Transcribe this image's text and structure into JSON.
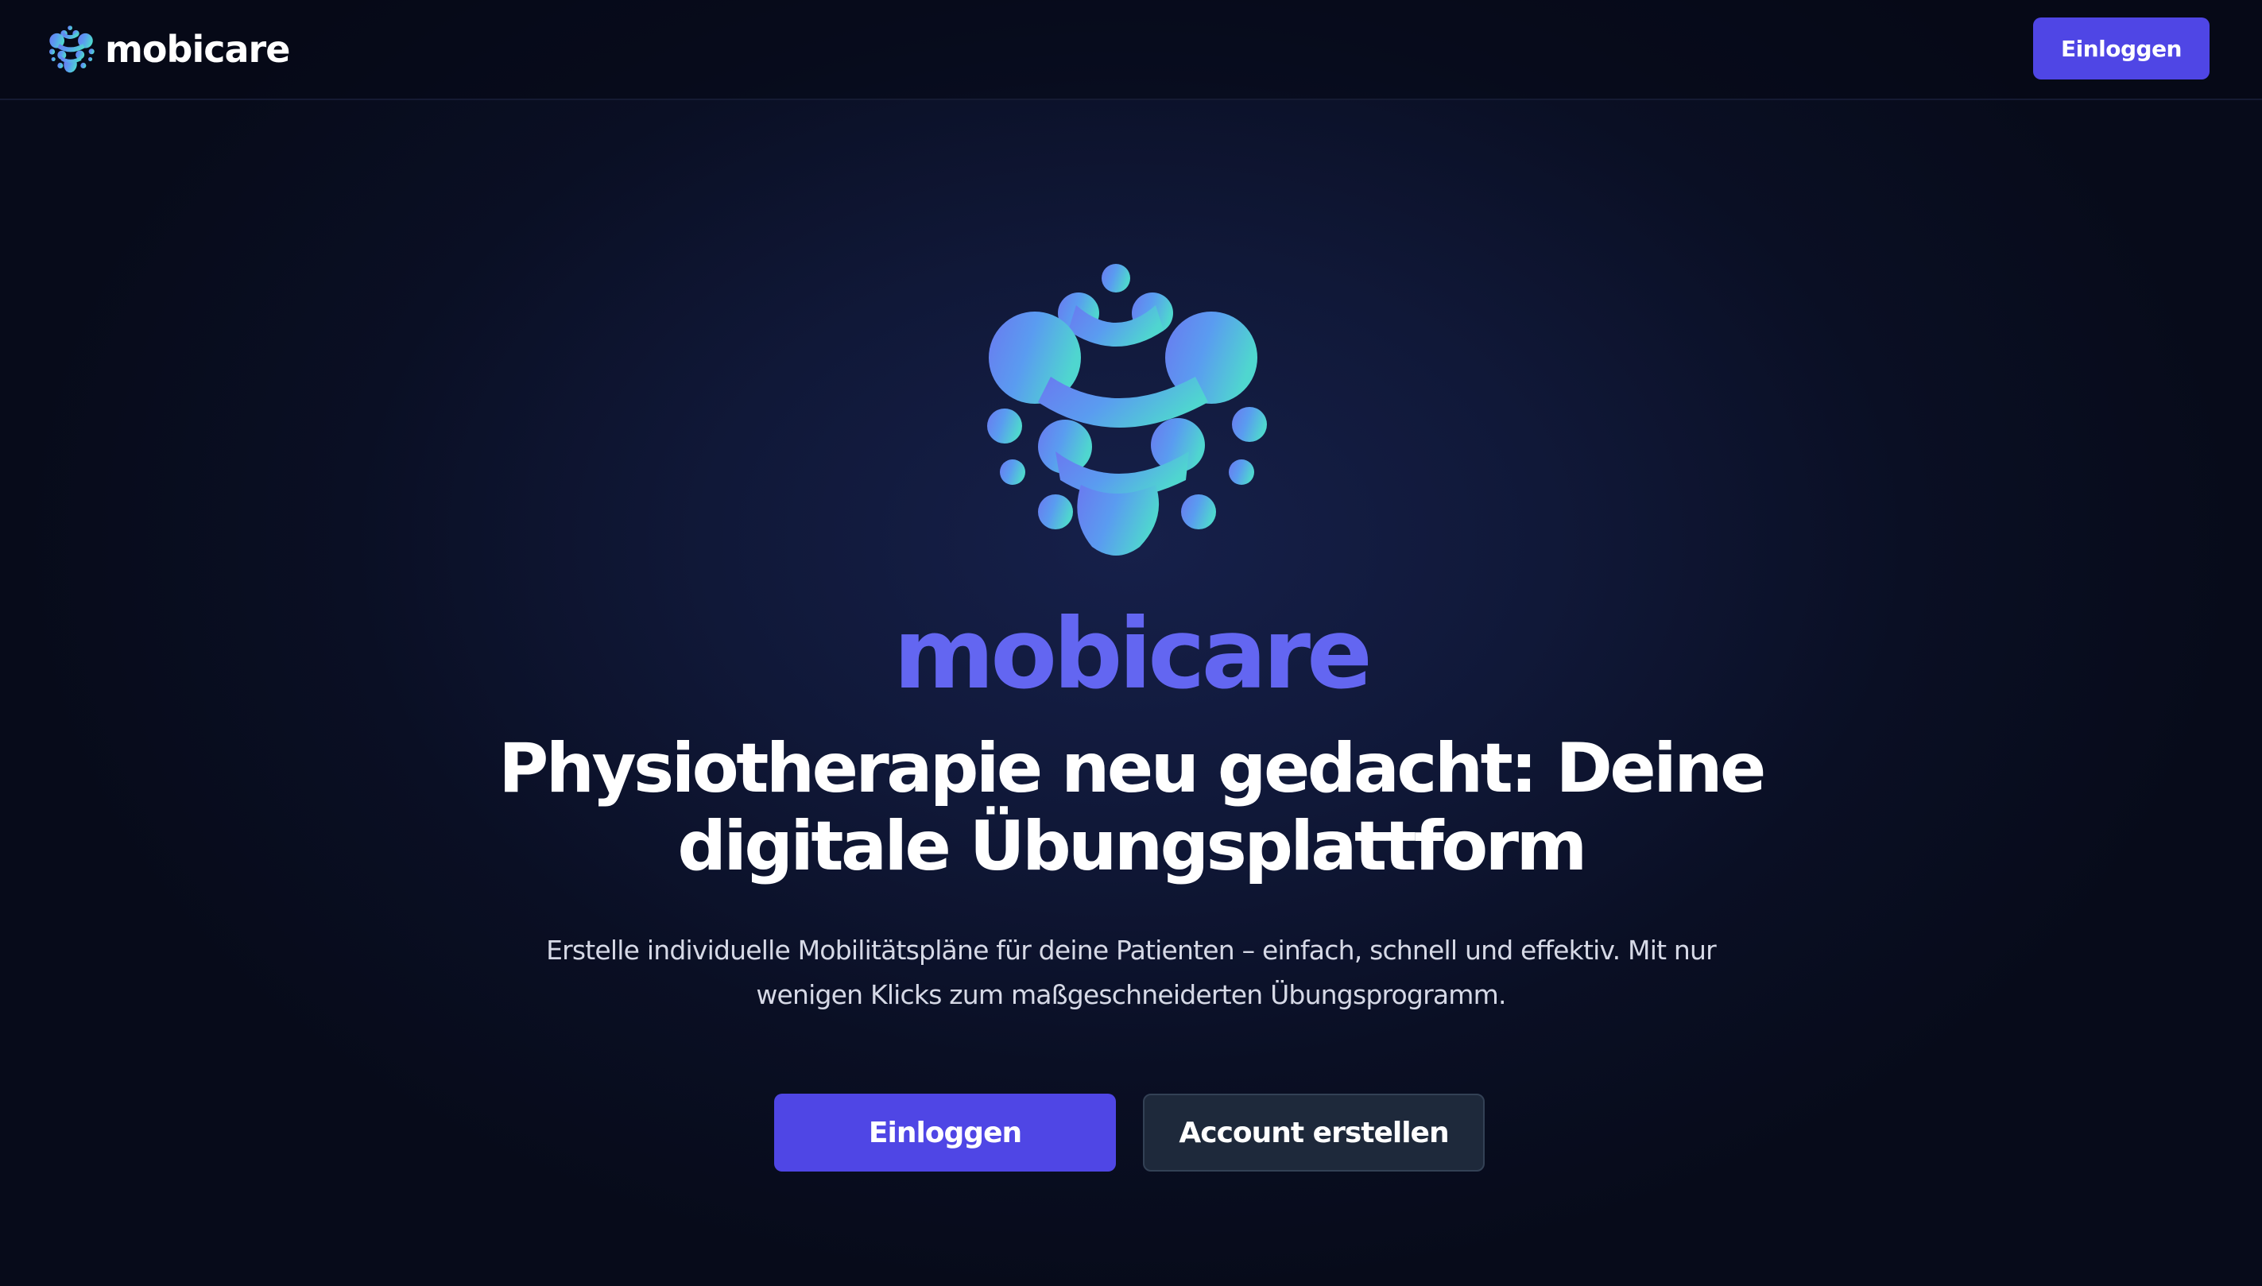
{
  "header": {
    "brand_name": "mobicare",
    "logo_icon": "mobicare-logo-icon",
    "login_label": "Einloggen"
  },
  "hero": {
    "logo_icon": "mobicare-logo-icon",
    "wordmark": "mobicare",
    "headline_line1": "Physiotherapie neu gedacht: Deine",
    "headline_line2": "digitale Übungsplattform",
    "subtitle_line1": "Erstelle individuelle Mobilitätspläne für deine Patienten – einfach, schnell und effektiv. Mit nur",
    "subtitle_line2": "wenigen Klicks zum maßgeschneiderten Übungsprogramm.",
    "primary_cta_label": "Einloggen",
    "secondary_cta_label": "Account erstellen"
  },
  "colors": {
    "background": "#0a0f24",
    "accent": "#4f46e5",
    "wordmark": "#6366f1",
    "logo_gradient_start": "#6a79f0",
    "logo_gradient_end": "#4fd6cf",
    "secondary_button": "#1e293b"
  }
}
